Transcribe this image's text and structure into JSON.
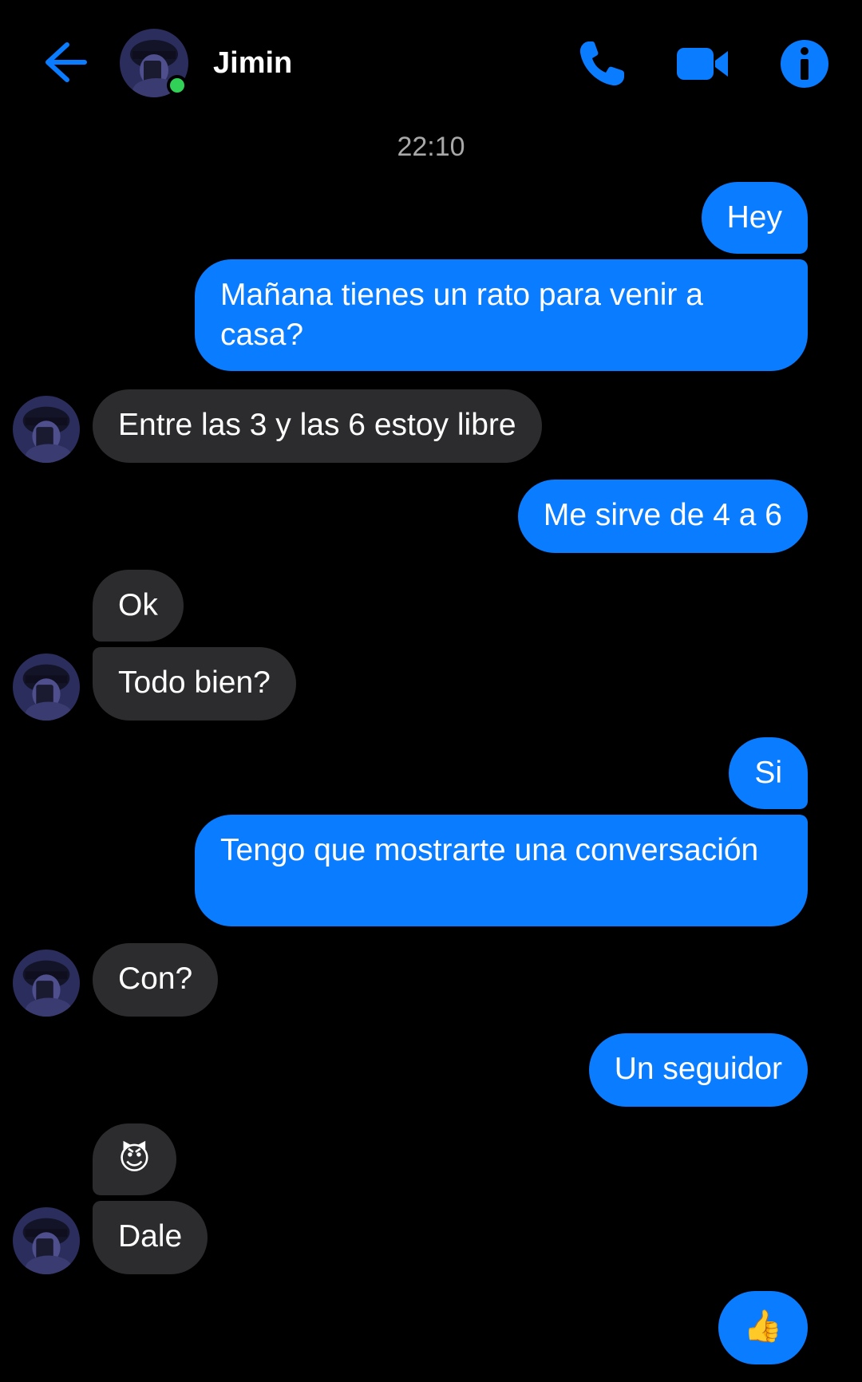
{
  "header": {
    "contact_name": "Jimin",
    "accent_color": "#0a7cff",
    "online_color": "#31d158",
    "icons": [
      "back-arrow-icon",
      "phone-icon",
      "video-camera-icon",
      "info-icon"
    ]
  },
  "thread": {
    "timestamp": "22:10",
    "messages": [
      {
        "from": "me",
        "text": "Hey"
      },
      {
        "from": "me",
        "text": "Mañana tienes un rato para venir a casa?"
      },
      {
        "from": "them",
        "text": "Entre las 3 y las 6 estoy libre"
      },
      {
        "from": "me",
        "text": "Me sirve de 4 a 6"
      },
      {
        "from": "them",
        "text": "Ok"
      },
      {
        "from": "them",
        "text": "Todo bien?"
      },
      {
        "from": "me",
        "text": "Si"
      },
      {
        "from": "me",
        "text": "Tengo que mostrarte una conversación"
      },
      {
        "from": "them",
        "text": "Con?"
      },
      {
        "from": "me",
        "text": "Un seguidor"
      },
      {
        "from": "them",
        "text": "😈"
      },
      {
        "from": "them",
        "text": "Dale"
      },
      {
        "from": "me",
        "text": "👍"
      }
    ]
  }
}
